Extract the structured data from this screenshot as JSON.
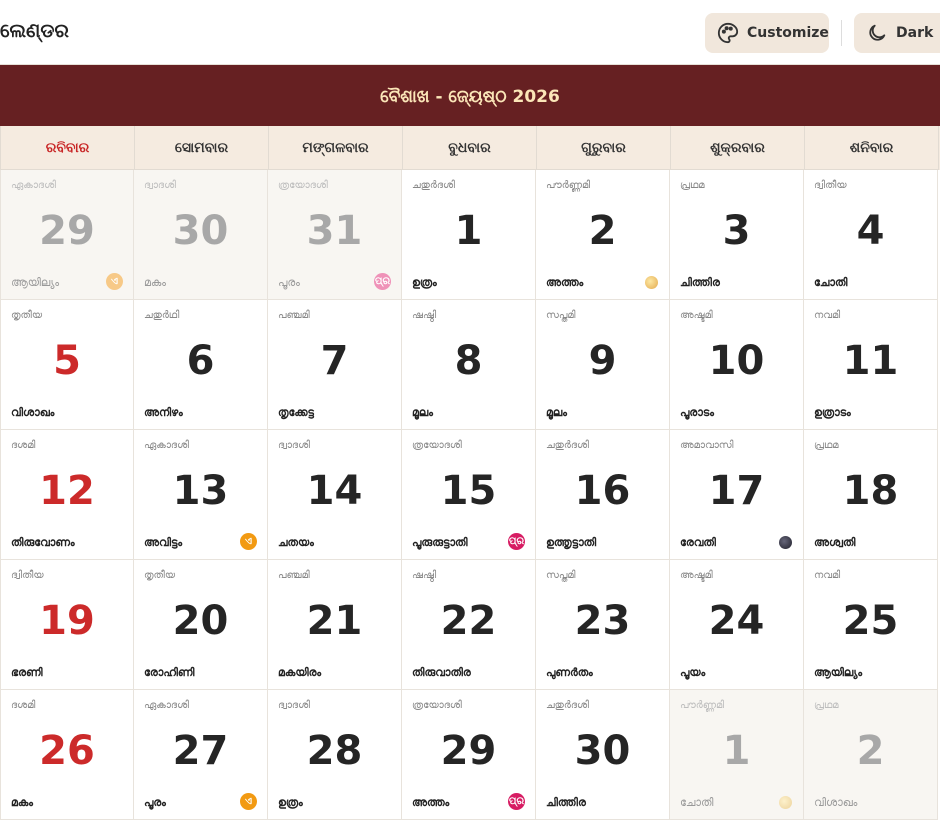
{
  "header": {
    "app_title": "ଲେଣ୍ଡର",
    "customize_label": "Customize",
    "dark_label": "Dark"
  },
  "banner": {
    "month_title": "ବୈଶାଖ - ଜ୍ୟେଷ୍ଠ 2026"
  },
  "weekdays": [
    "ରବିବାର",
    "ସୋମବାର",
    "ମଙ୍ଗଳବାର",
    "ବୁଧବାର",
    "ଗୁରୁବାର",
    "ଶୁକ୍ରବାର",
    "ଶନିବାର"
  ],
  "colors": {
    "banner": "#662022",
    "sunday": "#cc2a2a",
    "accent_orange": "#f29a12",
    "accent_pink": "#d71c63"
  },
  "days": [
    {
      "tithi": "ഏകാദശി",
      "day": "29",
      "star": "ആയില്യം",
      "other": true,
      "mark": "orange"
    },
    {
      "tithi": "ദ്വാദശി",
      "day": "30",
      "star": "മകം",
      "other": true,
      "mark": ""
    },
    {
      "tithi": "ത്രയോദശി",
      "day": "31",
      "star": "പൂരം",
      "other": true,
      "mark": "pink"
    },
    {
      "tithi": "ചതുർദശി",
      "day": "1",
      "star": "ഉത്രം",
      "other": false,
      "mark": ""
    },
    {
      "tithi": "പൗർണ്ണമി",
      "day": "2",
      "star": "അത്തം",
      "other": false,
      "mark": "full"
    },
    {
      "tithi": "പ്രഥമ",
      "day": "3",
      "star": "ചിത്തിര",
      "other": false,
      "mark": ""
    },
    {
      "tithi": "ദ്വിതീയ",
      "day": "4",
      "star": "ചോതി",
      "other": false,
      "mark": ""
    },
    {
      "tithi": "തൃതീയ",
      "day": "5",
      "star": "വിശാഖം",
      "other": false,
      "mark": ""
    },
    {
      "tithi": "ചതുർഥി",
      "day": "6",
      "star": "അനിഴം",
      "other": false,
      "mark": ""
    },
    {
      "tithi": "പഞ്ചമി",
      "day": "7",
      "star": "തൃക്കേട്ട",
      "other": false,
      "mark": ""
    },
    {
      "tithi": "ഷഷ്ഠി",
      "day": "8",
      "star": "മൂലം",
      "other": false,
      "mark": ""
    },
    {
      "tithi": "സപ്തമി",
      "day": "9",
      "star": "മൂലം",
      "other": false,
      "mark": ""
    },
    {
      "tithi": "അഷ്ടമി",
      "day": "10",
      "star": "പൂരാടം",
      "other": false,
      "mark": ""
    },
    {
      "tithi": "നവമി",
      "day": "11",
      "star": "ഉത്രാടം",
      "other": false,
      "mark": ""
    },
    {
      "tithi": "ദശമി",
      "day": "12",
      "star": "തിരുവോണം",
      "other": false,
      "mark": ""
    },
    {
      "tithi": "ഏകാദശി",
      "day": "13",
      "star": "അവിട്ടം",
      "other": false,
      "mark": "orange"
    },
    {
      "tithi": "ദ്വാദശി",
      "day": "14",
      "star": "ചതയം",
      "other": false,
      "mark": ""
    },
    {
      "tithi": "ത്രയോദശി",
      "day": "15",
      "star": "പൂരുരുട്ടാതി",
      "other": false,
      "mark": "pink"
    },
    {
      "tithi": "ചതുർദശി",
      "day": "16",
      "star": "ഉത്തൃട്ടാതി",
      "other": false,
      "mark": ""
    },
    {
      "tithi": "അമാവാസി",
      "day": "17",
      "star": "രേവതി",
      "other": false,
      "mark": "new"
    },
    {
      "tithi": "പ്രഥമ",
      "day": "18",
      "star": "അശ്വതി",
      "other": false,
      "mark": ""
    },
    {
      "tithi": "ദ്വിതീയ",
      "day": "19",
      "star": "ഭരണി",
      "other": false,
      "mark": ""
    },
    {
      "tithi": "തൃതീയ",
      "day": "20",
      "star": "രോഹിണി",
      "other": false,
      "mark": ""
    },
    {
      "tithi": "പഞ്ചമി",
      "day": "21",
      "star": "മകയിരം",
      "other": false,
      "mark": ""
    },
    {
      "tithi": "ഷഷ്ഠി",
      "day": "22",
      "star": "തിരുവാതിര",
      "other": false,
      "mark": ""
    },
    {
      "tithi": "സപ്തമി",
      "day": "23",
      "star": "പുണർതം",
      "other": false,
      "mark": ""
    },
    {
      "tithi": "അഷ്ടമി",
      "day": "24",
      "star": "പൂയം",
      "other": false,
      "mark": ""
    },
    {
      "tithi": "നവമി",
      "day": "25",
      "star": "ആയില്യം",
      "other": false,
      "mark": ""
    },
    {
      "tithi": "ദശമി",
      "day": "26",
      "star": "മകം",
      "other": false,
      "mark": ""
    },
    {
      "tithi": "ഏകാദശി",
      "day": "27",
      "star": "പൂരം",
      "other": false,
      "mark": "orange"
    },
    {
      "tithi": "ദ്വാദശി",
      "day": "28",
      "star": "ഉത്രം",
      "other": false,
      "mark": ""
    },
    {
      "tithi": "ത്രയോദശി",
      "day": "29",
      "star": "അത്തം",
      "other": false,
      "mark": "pink"
    },
    {
      "tithi": "ചതുർദശി",
      "day": "30",
      "star": "ചിത്തിര",
      "other": false,
      "mark": ""
    },
    {
      "tithi": "പൗർണ്ണമി",
      "day": "1",
      "star": "ചോതി",
      "other": true,
      "mark": "full"
    },
    {
      "tithi": "പ്രഥമ",
      "day": "2",
      "star": "വിശാഖം",
      "other": true,
      "mark": ""
    }
  ]
}
